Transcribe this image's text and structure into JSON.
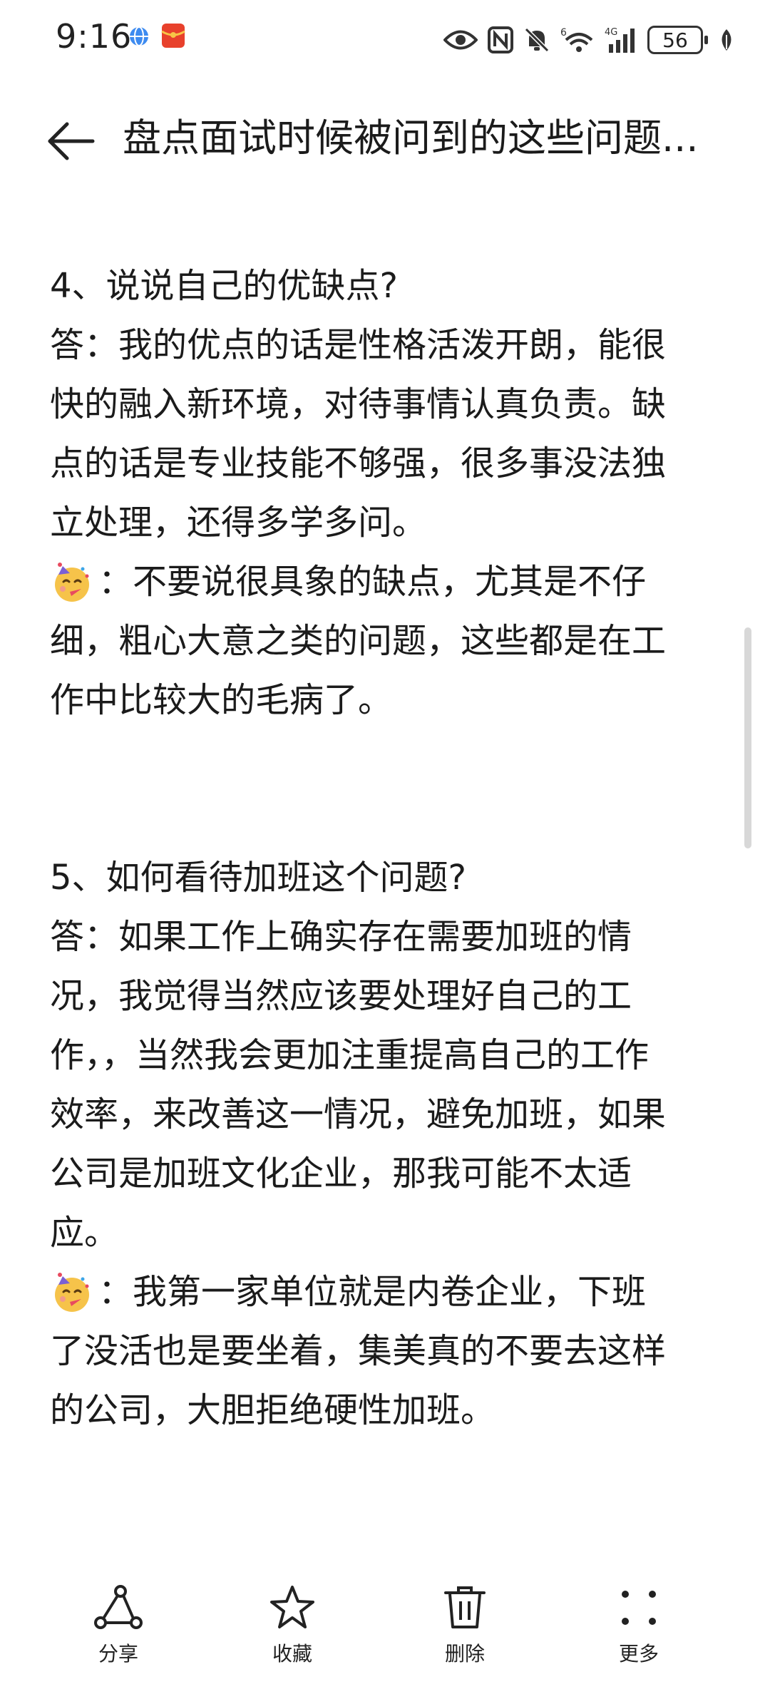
{
  "status_bar": {
    "time": "9:16",
    "left_icons": [
      "browser-globe-icon",
      "red-envelope-icon"
    ],
    "right_icons": [
      "eye-icon",
      "nfc-icon",
      "mute-bell-icon",
      "wifi-6-icon",
      "signal-4g-icon",
      "battery-icon",
      "leaf-icon"
    ],
    "battery_level": "56"
  },
  "header": {
    "title": "盘点面试时候被问到的这些问题...",
    "back_icon": "arrow-left-icon"
  },
  "article": {
    "q4": {
      "question": "4、说说自己的优缺点?",
      "answer_lines": [
        "答：我的优点的话是性格活泼开朗，能很",
        "快的融入新环境，对待事情认真负责。缺",
        "点的话是专业技能不够强，很多事没法独",
        "立处理，还得多学多问。"
      ],
      "tip_line_1": "：不要说很具象的缺点，尤其是不仔",
      "tip_lines": [
        "细，粗心大意之类的问题，这些都是在工",
        "作中比较大的毛病了。"
      ]
    },
    "q5": {
      "question": "5、如何看待加班这个问题?",
      "answer_lines": [
        "答：如果工作上确实存在需要加班的情",
        "况，我觉得当然应该要处理好自己的工",
        "作，，当然我会更加注重提高自己的工作",
        "效率，来改善这一情况，避免加班，如果",
        "公司是加班文化企业，那我可能不太适",
        "应。"
      ],
      "tip_line_1": "：我第一家单位就是内卷企业，下班",
      "tip_lines": [
        "了没活也是要坐着，集美真的不要去这样",
        "的公司，大胆拒绝硬性加班。"
      ]
    },
    "emoji_icon": "party-face-emoji-icon"
  },
  "toolbar": {
    "share_label": "分享",
    "favorite_label": "收藏",
    "delete_label": "删除",
    "more_label": "更多",
    "icons": [
      "share-icon",
      "star-icon",
      "trash-icon",
      "more-dots-icon"
    ]
  }
}
